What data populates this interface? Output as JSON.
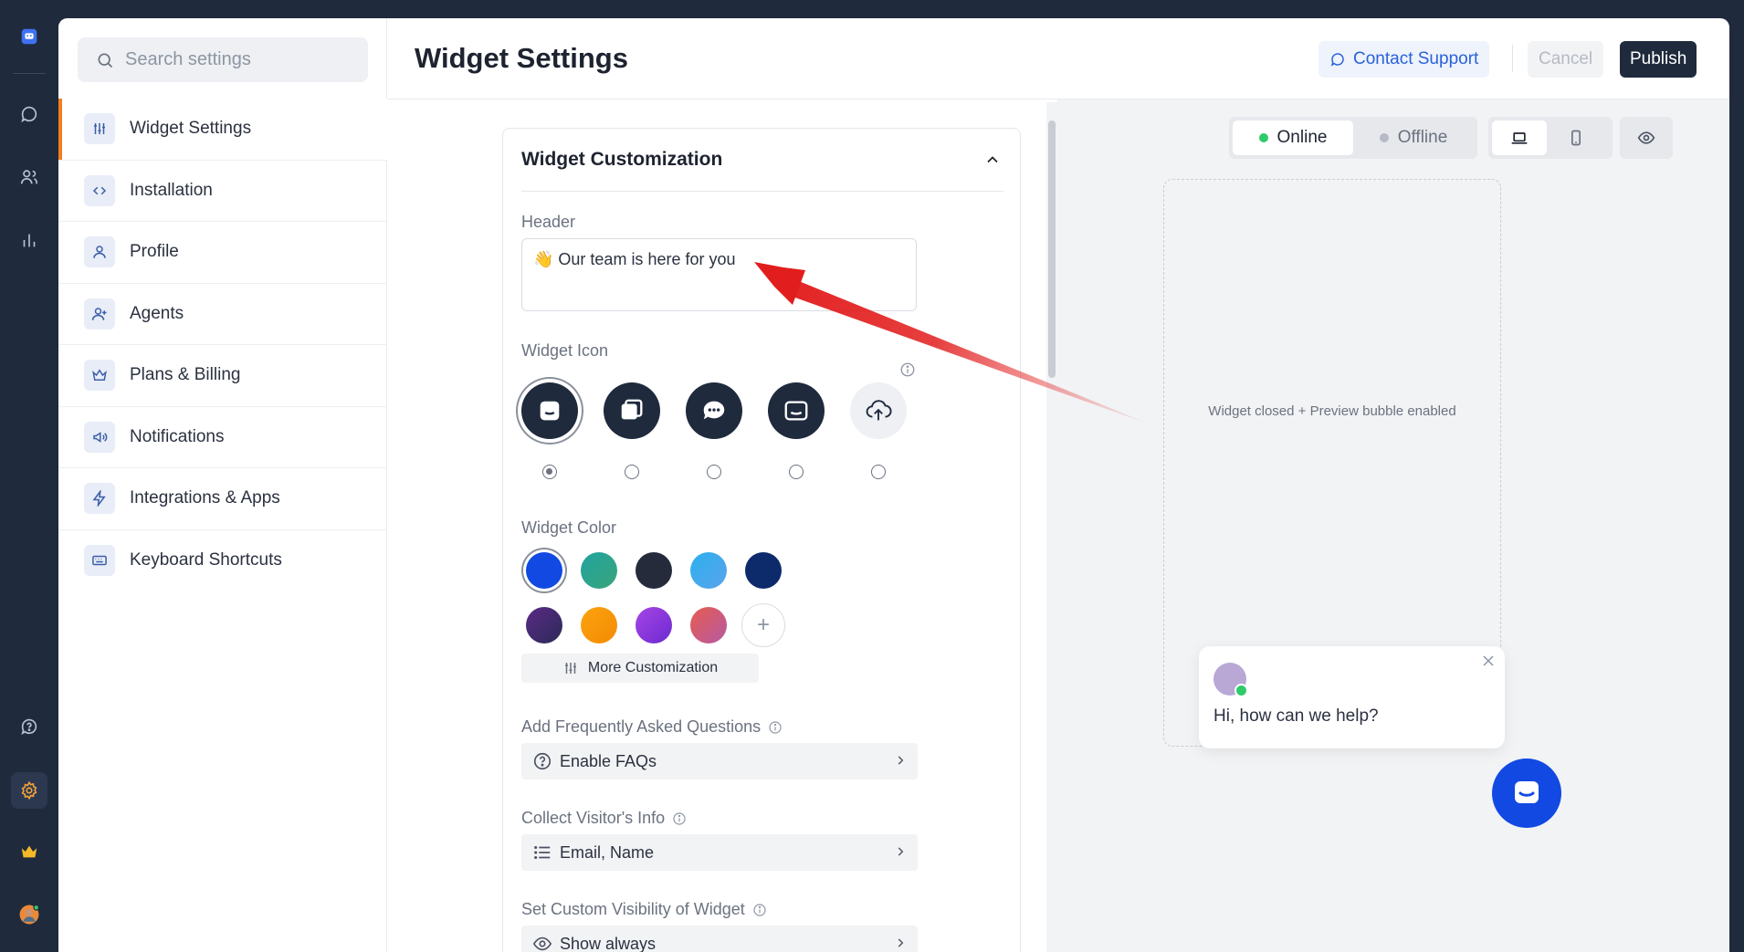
{
  "rail": {
    "items": [
      "logo-icon",
      "chat-icon",
      "contacts-icon",
      "reports-icon",
      "help-icon",
      "settings-icon",
      "crown-icon",
      "user-avatar"
    ]
  },
  "search": {
    "placeholder": "Search settings"
  },
  "sidebar": {
    "items": [
      {
        "label": "Widget Settings",
        "icon": "sliders-icon",
        "active": true
      },
      {
        "label": "Installation",
        "icon": "code-icon"
      },
      {
        "label": "Profile",
        "icon": "user-icon"
      },
      {
        "label": "Agents",
        "icon": "user-plus-icon"
      },
      {
        "label": "Plans & Billing",
        "icon": "crown-icon"
      },
      {
        "label": "Notifications",
        "icon": "megaphone-icon"
      },
      {
        "label": "Integrations & Apps",
        "icon": "lightning-icon"
      },
      {
        "label": "Keyboard Shortcuts",
        "icon": "keyboard-icon"
      }
    ]
  },
  "header": {
    "title": "Widget Settings",
    "support_label": "Contact Support",
    "cancel_label": "Cancel",
    "publish_label": "Publish"
  },
  "card": {
    "title": "Widget Customization",
    "header_label": "Header",
    "header_value": "👋 Our team is here for you",
    "icon_label": "Widget Icon",
    "icon_options": [
      "widget-icon-1",
      "widget-icon-2",
      "widget-icon-3",
      "widget-icon-4",
      "upload-icon"
    ],
    "selected_icon": 0,
    "color_label": "Widget Color",
    "colors": [
      "#1249e3",
      "#2aa79b",
      "#252b3b",
      "#3fa6f0",
      "#0d2a6b",
      "#4a2a6e",
      "#f28b00",
      "#8b35d9",
      "#d9595b"
    ],
    "selected_color": 0,
    "more_label": "More Customization",
    "faq_label": "Add Frequently Asked Questions",
    "faq_value": "Enable FAQs",
    "visitor_label": "Collect Visitor's Info",
    "visitor_value": "Email, Name",
    "visibility_label": "Set Custom Visibility of Widget",
    "visibility_value": "Show always"
  },
  "preview": {
    "online_label": "Online",
    "offline_label": "Offline",
    "status_colors": {
      "online": "#2fcb6a",
      "offline": "#b6bac4"
    },
    "caption": "Widget closed + Preview bubble enabled",
    "bubble_text": "Hi, how can we help?"
  },
  "colors": {
    "accent": "#f07f21",
    "brand_blue": "#1249e3",
    "dark": "#1f2a3d",
    "arrow": "#e21d1d"
  }
}
